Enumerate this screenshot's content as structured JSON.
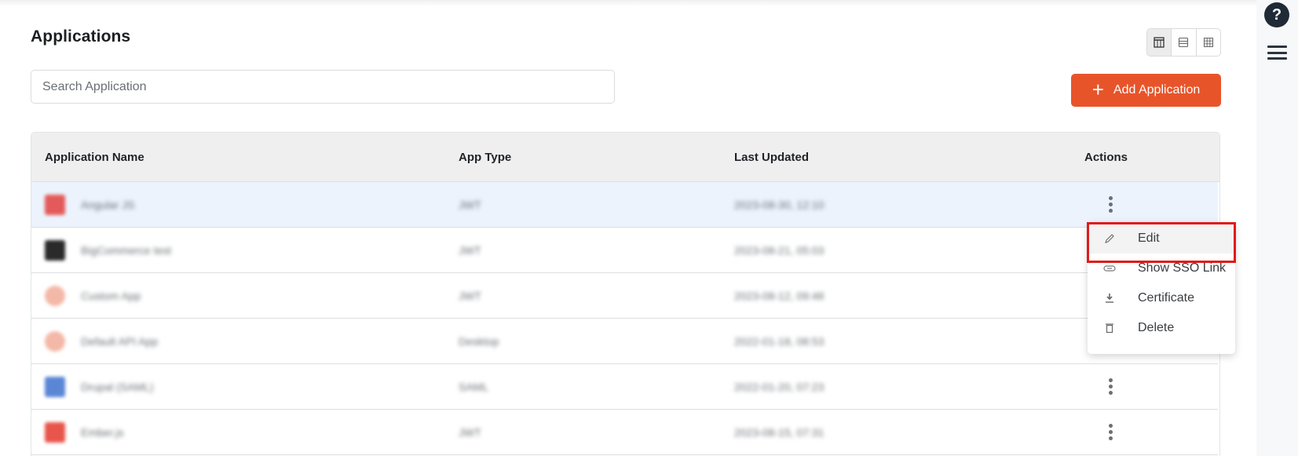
{
  "page": {
    "title": "Applications"
  },
  "search": {
    "placeholder": "Search Application",
    "value": ""
  },
  "view_toggle": {
    "options": [
      {
        "icon": "table-view-icon",
        "active": true
      },
      {
        "icon": "list-view-icon",
        "active": false
      },
      {
        "icon": "grid-view-icon",
        "active": false
      }
    ]
  },
  "toolbar": {
    "add_label": "Add Application",
    "add_icon": "plus-icon",
    "brand_color": "#e8542a"
  },
  "table": {
    "columns": [
      "Application Name",
      "App Type",
      "Last Updated",
      "Actions"
    ],
    "rows": [
      {
        "name": "Angular JS",
        "type": "JWT",
        "updated": "2023-08-30, 12:10",
        "icon_color": "#e45a5a",
        "highlighted": true
      },
      {
        "name": "BigCommerce test",
        "type": "JWT",
        "updated": "2023-08-21, 05:03",
        "icon_color": "#2a2a2a",
        "highlighted": false
      },
      {
        "name": "Custom App",
        "type": "JWT",
        "updated": "2023-08-12, 09:48",
        "icon_color": "#f4b8a8",
        "highlighted": false
      },
      {
        "name": "Default API App",
        "type": "Desktop",
        "updated": "2022-01-18, 08:53",
        "icon_color": "#f4b8a8",
        "highlighted": false
      },
      {
        "name": "Drupal (SAML)",
        "type": "SAML",
        "updated": "2022-01-20, 07:23",
        "icon_color": "#5b86d6",
        "highlighted": false
      },
      {
        "name": "Ember.js",
        "type": "JWT",
        "updated": "2023-08-15, 07:31",
        "icon_color": "#e8554a",
        "highlighted": false
      }
    ]
  },
  "actions_menu": {
    "items": [
      {
        "label": "Edit",
        "icon": "pencil-icon",
        "active": true
      },
      {
        "label": "Show SSO Link",
        "icon": "link-icon",
        "active": false
      },
      {
        "label": "Certificate",
        "icon": "download-icon",
        "active": false
      },
      {
        "label": "Delete",
        "icon": "trash-icon",
        "active": false
      }
    ],
    "highlight_color": "#e01b1b"
  },
  "rightbar": {
    "help_label": "?"
  }
}
